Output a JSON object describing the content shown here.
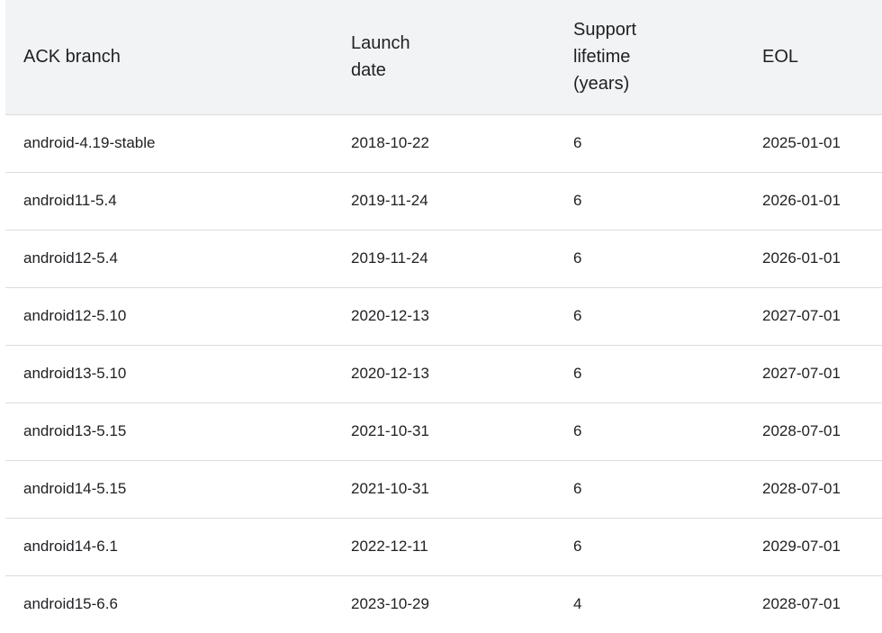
{
  "table": {
    "headers": {
      "branch": "ACK branch",
      "launch_line1": "Launch",
      "launch_line2": "date",
      "support_line1": "Support",
      "support_line2": "lifetime",
      "support_line3": "(years)",
      "eol": "EOL"
    },
    "rows": [
      {
        "branch": "android-4.19-stable",
        "launch": "2018-10-22",
        "support": "6",
        "eol": "2025-01-01"
      },
      {
        "branch": "android11-5.4",
        "launch": "2019-11-24",
        "support": "6",
        "eol": "2026-01-01"
      },
      {
        "branch": "android12-5.4",
        "launch": "2019-11-24",
        "support": "6",
        "eol": "2026-01-01"
      },
      {
        "branch": "android12-5.10",
        "launch": "2020-12-13",
        "support": "6",
        "eol": "2027-07-01"
      },
      {
        "branch": "android13-5.10",
        "launch": "2020-12-13",
        "support": "6",
        "eol": "2027-07-01"
      },
      {
        "branch": "android13-5.15",
        "launch": "2021-10-31",
        "support": "6",
        "eol": "2028-07-01"
      },
      {
        "branch": "android14-5.15",
        "launch": "2021-10-31",
        "support": "6",
        "eol": "2028-07-01"
      },
      {
        "branch": "android14-6.1",
        "launch": "2022-12-11",
        "support": "6",
        "eol": "2029-07-01"
      },
      {
        "branch": "android15-6.6",
        "launch": "2023-10-29",
        "support": "4",
        "eol": "2028-07-01"
      }
    ]
  }
}
